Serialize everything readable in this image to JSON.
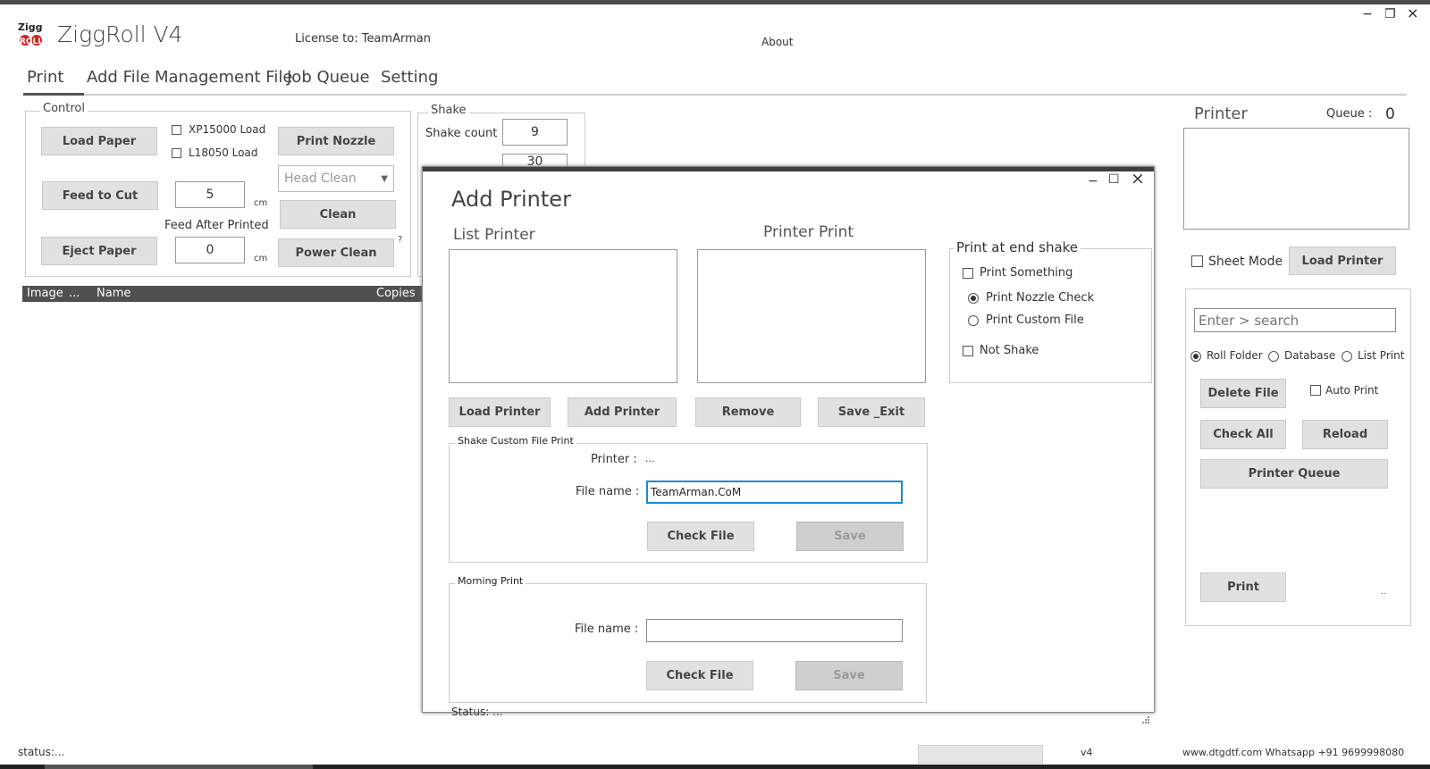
{
  "app": {
    "title": "ZiggRoll V4",
    "logo_text": "Zigg Roll",
    "license": "License to: TeamArman",
    "about": "About",
    "win_min": "−",
    "win_restore": "❐",
    "win_close": "×"
  },
  "menu": {
    "items": [
      "Print",
      "Add File",
      "Management File",
      "Job Queue",
      "Setting"
    ]
  },
  "control": {
    "title": "Control",
    "load_paper": "Load Paper",
    "xp15000": "XP15000 Load",
    "l18050": "L18050 Load",
    "print_nozzle": "Print Nozzle",
    "feed_to_cut": "Feed to Cut",
    "feed_value": "5",
    "cm1": "cm",
    "head_clean": "Head Clean",
    "clean": "Clean",
    "feed_after_printed": "Feed After Printed",
    "eject_paper": "Eject Paper",
    "feed_after_value": "0",
    "cm2": "cm",
    "power_clean": "Power Clean",
    "question": "?"
  },
  "shake": {
    "title": "Shake",
    "count_label": "Shake count",
    "count_value": "9",
    "second_value": "30"
  },
  "table": {
    "columns": [
      "Image",
      "...",
      "Name",
      "Copies"
    ]
  },
  "right_panel": {
    "printer_label": "Printer",
    "queue_label": "Queue :",
    "queue_value": "0",
    "sheet_mode": "Sheet Mode",
    "load_printer": "Load Printer",
    "search_placeholder": "Enter > search",
    "radio_roll": "Roll Folder",
    "radio_db": "Database",
    "radio_list": "List Print",
    "delete_file": "Delete File",
    "auto_print": "Auto Print",
    "check_all": "Check All",
    "reload": "Reload",
    "printer_queue": "Printer Queue",
    "print": "Print",
    "dots": ".."
  },
  "dialog": {
    "title": "Add Printer",
    "list_printer": "List Printer",
    "printer_print": "Printer Print",
    "print_at_end_shake": "Print at end shake",
    "print_something": "Print Something",
    "print_nozzle_check": "Print Nozzle Check",
    "print_custom_file": "Print Custom File",
    "not_shake": "Not Shake",
    "load_printer": "Load Printer",
    "add_printer": "Add Printer",
    "remove": "Remove",
    "save_exit": "Save _Exit",
    "shake_custom": {
      "title": "Shake Custom File Print",
      "printer_label": "Printer :",
      "printer_value": "...",
      "file_label": "File name :",
      "file_value": "TeamArman.CoM",
      "check_file": "Check File",
      "save": "Save"
    },
    "morning": {
      "title": "Morning Print",
      "file_label": "File name :",
      "file_value": "",
      "check_file": "Check File",
      "save": "Save"
    },
    "status": "Status: ...",
    "win_min": "−",
    "win_max": "☐",
    "win_close": "×"
  },
  "statusbar": {
    "status": "status:...",
    "version": "v4",
    "contact": "www.dtgdtf.com Whatsapp +91 9699998080"
  }
}
